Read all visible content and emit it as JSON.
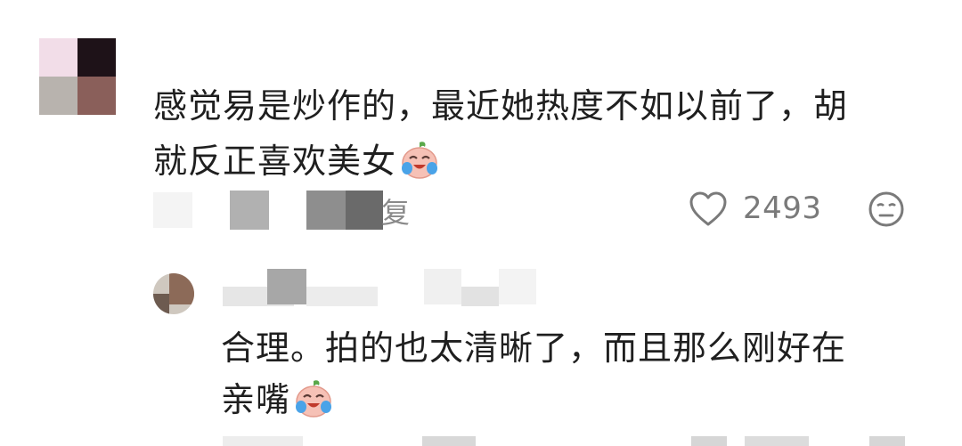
{
  "comment": {
    "text_line1": "感觉易是炒作的，最近她热度不如以前了，胡",
    "text_line2": "就反正喜欢美女",
    "reply_label": "复",
    "like_count": "2493",
    "like_icon": "heart-outline-icon",
    "dislike_icon": "meh-face-icon",
    "emoji_icon": "crying-laughing-peach-emoji"
  },
  "reply": {
    "text_line1": "合理。拍的也太清晰了，而且那么刚好在",
    "text_line2": "亲嘴",
    "emoji_icon": "crying-laughing-peach-emoji"
  },
  "colors": {
    "text": "#1f1f1f",
    "meta": "#8a8a8a"
  }
}
